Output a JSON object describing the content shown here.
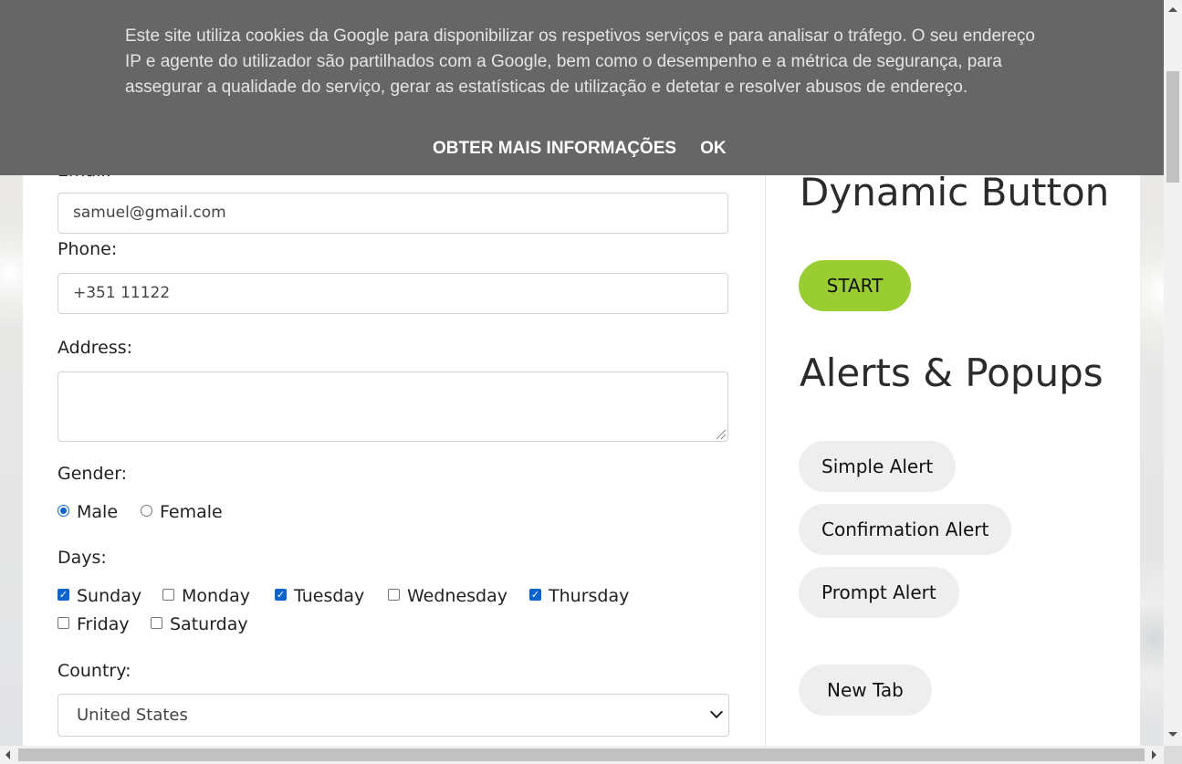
{
  "form": {
    "email_label_partial": "Email:",
    "email_value": "samuel@gmail.com",
    "phone_label": "Phone:",
    "phone_value": "+351 11122",
    "address_label": "Address:",
    "address_value": "",
    "gender_label": "Gender:",
    "gender_options": [
      {
        "label": "Male",
        "checked": true
      },
      {
        "label": "Female",
        "checked": false
      }
    ],
    "days_label": "Days:",
    "days": [
      {
        "label": "Sunday",
        "checked": true
      },
      {
        "label": "Monday",
        "checked": false
      },
      {
        "label": "Tuesday",
        "checked": true
      },
      {
        "label": "Wednesday",
        "checked": false
      },
      {
        "label": "Thursday",
        "checked": true
      },
      {
        "label": "Friday",
        "checked": false
      },
      {
        "label": "Saturday",
        "checked": false
      }
    ],
    "country_label": "Country:",
    "country_value": "United States"
  },
  "sidebar": {
    "dynamic_button_title": "Dynamic Button",
    "start_label": "START",
    "alerts_title": "Alerts & Popups",
    "simple_alert_label": "Simple Alert",
    "confirmation_alert_label": "Confirmation Alert",
    "prompt_alert_label": "Prompt Alert",
    "new_tab_label": "New Tab"
  },
  "cookie_banner": {
    "text": "Este site utiliza cookies da Google para disponibilizar os respetivos serviços e para analisar o tráfego. O seu endereço IP e agente do utilizador são partilhados com a Google, bem como o desempenho e a métrica de segurança, para assegurar a qualidade do serviço, gerar as estatísticas de utilização e detetar e resolver abusos de endereço.",
    "more_info_label": "OBTER MAIS INFORMAÇÕES",
    "ok_label": "OK"
  },
  "colors": {
    "start_button": "#9acd32",
    "banner_bg": "#666666",
    "checkbox_accent": "#0b63ce"
  }
}
